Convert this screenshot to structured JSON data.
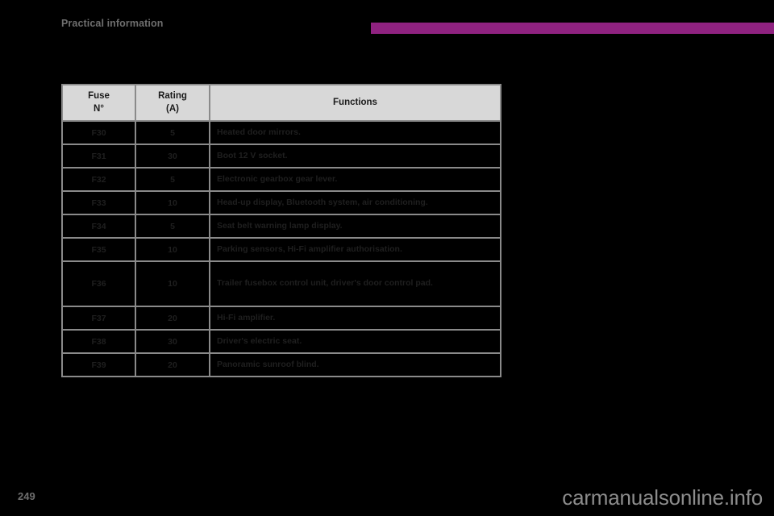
{
  "header": {
    "section_title": "Practical information",
    "accent_color": "#8f2280"
  },
  "table": {
    "columns": [
      {
        "label_line1": "Fuse",
        "label_line2": "N°"
      },
      {
        "label_line1": "Rating",
        "label_line2": "(A)"
      },
      {
        "label_line1": "Functions",
        "label_line2": ""
      }
    ],
    "rows": [
      {
        "fuse": "F30",
        "rating": "5",
        "function": "Heated door mirrors."
      },
      {
        "fuse": "F31",
        "rating": "30",
        "function": "Boot 12 V socket."
      },
      {
        "fuse": "F32",
        "rating": "5",
        "function": "Electronic gearbox gear lever."
      },
      {
        "fuse": "F33",
        "rating": "10",
        "function": "Head-up display, Bluetooth system, air conditioning."
      },
      {
        "fuse": "F34",
        "rating": "5",
        "function": "Seat belt warning lamp display."
      },
      {
        "fuse": "F35",
        "rating": "10",
        "function": "Parking sensors, Hi-Fi amplifier authorisation."
      },
      {
        "fuse": "F36",
        "rating": "10",
        "function": "Trailer fusebox control unit, driver's door control pad."
      },
      {
        "fuse": "F37",
        "rating": "20",
        "function": "Hi-Fi amplifier."
      },
      {
        "fuse": "F38",
        "rating": "30",
        "function": "Driver's electric seat."
      },
      {
        "fuse": "F39",
        "rating": "20",
        "function": "Panoramic sunroof blind."
      }
    ]
  },
  "footer": {
    "page_number": "249",
    "watermark": "carmanualsonline.info"
  }
}
